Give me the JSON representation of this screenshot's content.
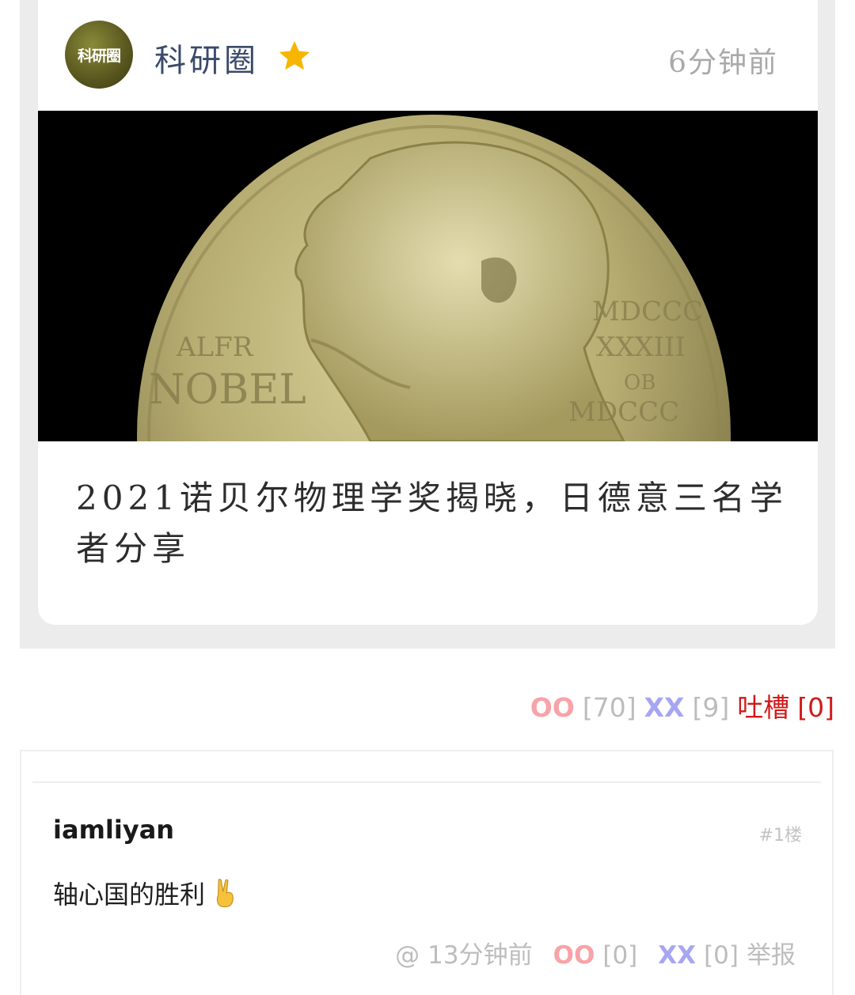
{
  "embed": {
    "avatar_text": "科研圈",
    "source_name": "科研圈",
    "time": "6分钟前",
    "cover_text": {
      "left_line1": "ALFR",
      "left_line2": "NOBEL",
      "right_line1": "MDCCC",
      "right_line2": "XXXIII",
      "right_line3": "OB",
      "right_line4": "MDCCC"
    },
    "title": "2021诺贝尔物理学奖揭晓，日德意三名学者分享"
  },
  "vote": {
    "oo_label": "OO",
    "oo_count": "[70]",
    "xx_label": "XX",
    "xx_count": "[9]",
    "tucao_label": "吐槽",
    "tucao_count": "[0]"
  },
  "comment": {
    "author": "iamliyan",
    "floor": "#1楼",
    "text": "轴心国的胜利",
    "at": "@",
    "time": "13分钟前",
    "oo_label": "OO",
    "oo_count": "[0]",
    "xx_label": "XX",
    "xx_count": "[0]",
    "report": "举报"
  }
}
